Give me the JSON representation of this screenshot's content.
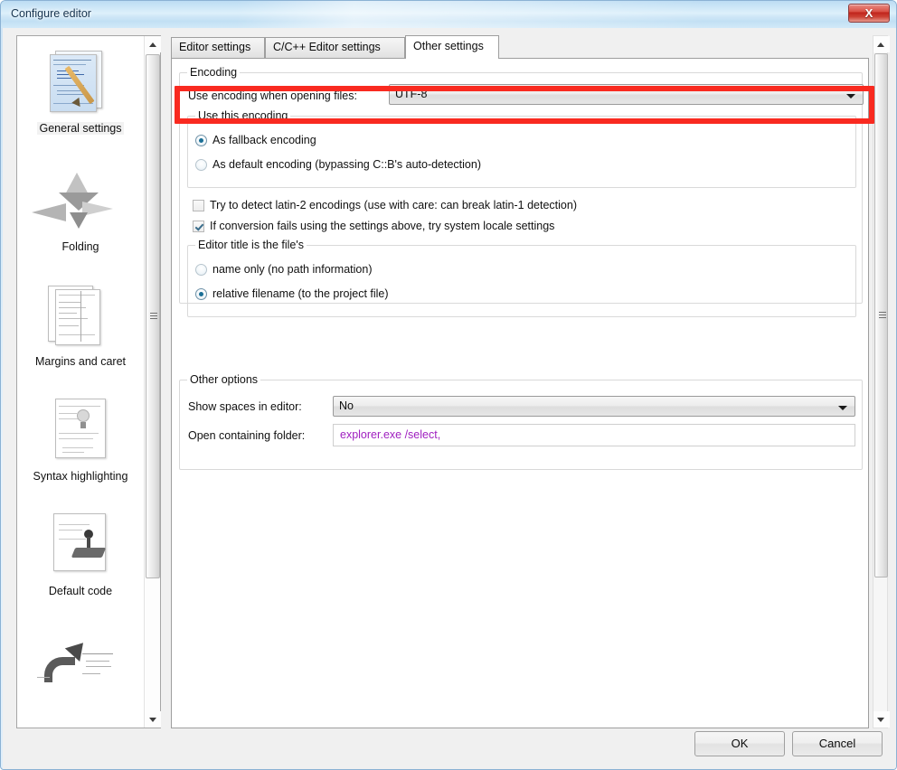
{
  "window": {
    "title": "Configure editor",
    "close_label": "X"
  },
  "sidebar": {
    "items": [
      {
        "label": "General settings",
        "icon": "document-pencil-icon",
        "selected": true
      },
      {
        "label": "Folding",
        "icon": "origami-crane-icon",
        "selected": false
      },
      {
        "label": "Margins and caret",
        "icon": "lined-pages-icon",
        "selected": false
      },
      {
        "label": "Syntax highlighting",
        "icon": "highlighted-page-icon",
        "selected": false
      },
      {
        "label": "Default code",
        "icon": "stamp-page-icon",
        "selected": false
      },
      {
        "label": "",
        "icon": "arrow-class-icon",
        "selected": false
      }
    ],
    "scrollbar": {
      "up_icon": "scroll-up-arrow-icon",
      "down_icon": "scroll-down-arrow-icon",
      "grip_icon": "scroll-grip-icon"
    }
  },
  "tabs": [
    {
      "label": "Editor settings",
      "active": false
    },
    {
      "label": "C/C++ Editor settings",
      "active": false
    },
    {
      "label": "Other settings",
      "active": true
    }
  ],
  "encoding_group": {
    "legend": "Encoding",
    "combo_label": "Use encoding when opening files:",
    "combo_value": "UTF-8",
    "combo_arrow_icon": "chevron-down-icon",
    "highlight_color": "#f92a20",
    "use_this_encoding": {
      "legend": "Use this encoding",
      "options": [
        {
          "label": "As fallback encoding",
          "selected": true
        },
        {
          "label": "As default encoding (bypassing C::B's auto-detection)",
          "selected": false
        }
      ]
    },
    "checkboxes": [
      {
        "label": "Try to detect latin-2 encodings (use with care: can break latin-1 detection)",
        "checked": false
      },
      {
        "label": "If conversion fails using the settings above, try system locale settings",
        "checked": true
      }
    ]
  },
  "editor_title_group": {
    "legend": "Editor title is the file's",
    "options": [
      {
        "label": "name only (no path information)",
        "selected": false
      },
      {
        "label": "relative filename (to the project file)",
        "selected": true
      }
    ]
  },
  "other_options_group": {
    "legend": "Other options",
    "show_spaces_label": "Show spaces in editor:",
    "show_spaces_value": "No",
    "show_spaces_arrow_icon": "chevron-down-icon",
    "open_folder_label": "Open containing folder:",
    "open_folder_value": "explorer.exe /select,",
    "open_folder_value_color": "#a020c0"
  },
  "footer": {
    "ok_label": "OK",
    "cancel_label": "Cancel"
  }
}
